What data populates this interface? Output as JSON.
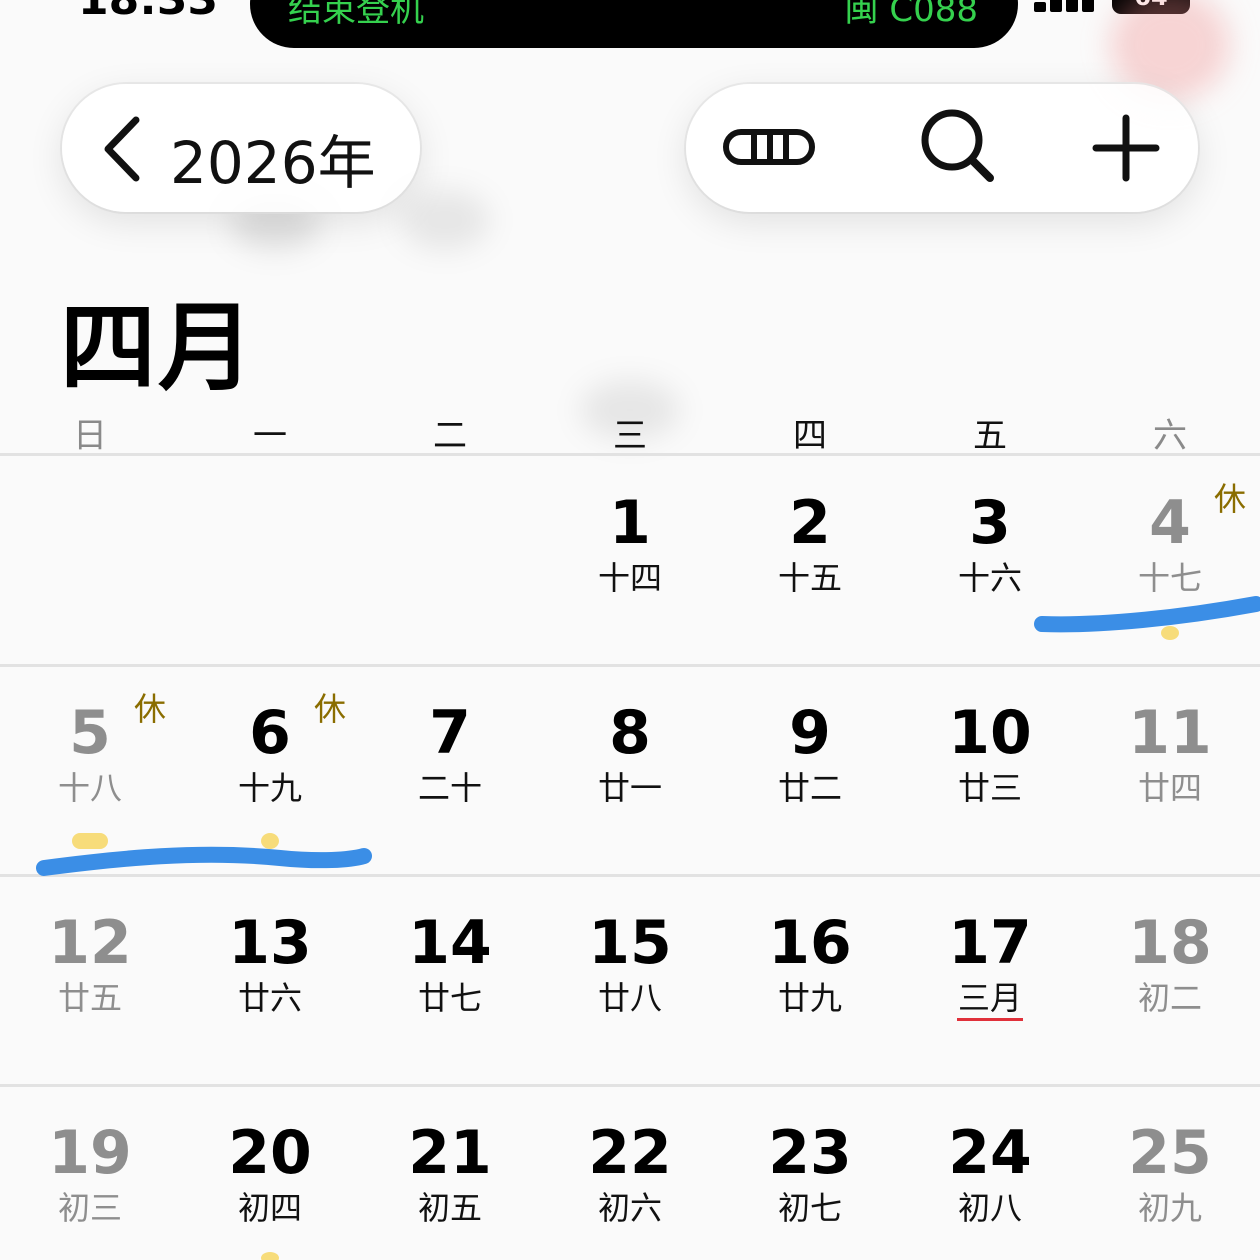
{
  "status_bar": {
    "time": "18:33",
    "island_left": "结束登机",
    "island_right": "闽 C088",
    "battery": "64"
  },
  "nav": {
    "back_year": "2026年",
    "icons": [
      "chevron-left-icon",
      "list-view-icon",
      "search-icon",
      "plus-icon"
    ]
  },
  "month_title": "四月",
  "weekdays": [
    "日",
    "一",
    "二",
    "三",
    "四",
    "五",
    "六"
  ],
  "days": [
    {
      "num": "1",
      "lunar": "十四"
    },
    {
      "num": "2",
      "lunar": "十五"
    },
    {
      "num": "3",
      "lunar": "十六"
    },
    {
      "num": "4",
      "lunar": "十七",
      "tag": "休"
    },
    {
      "num": "5",
      "lunar": "十八",
      "tag": "休"
    },
    {
      "num": "6",
      "lunar": "十九",
      "tag": "休"
    },
    {
      "num": "7",
      "lunar": "二十"
    },
    {
      "num": "8",
      "lunar": "廿一"
    },
    {
      "num": "9",
      "lunar": "廿二"
    },
    {
      "num": "10",
      "lunar": "廿三"
    },
    {
      "num": "11",
      "lunar": "廿四"
    },
    {
      "num": "12",
      "lunar": "廿五"
    },
    {
      "num": "13",
      "lunar": "廿六"
    },
    {
      "num": "14",
      "lunar": "廿七"
    },
    {
      "num": "15",
      "lunar": "廿八"
    },
    {
      "num": "16",
      "lunar": "廿九"
    },
    {
      "num": "17",
      "lunar": "三月"
    },
    {
      "num": "18",
      "lunar": "初二"
    },
    {
      "num": "19",
      "lunar": "初三"
    },
    {
      "num": "20",
      "lunar": "初四"
    },
    {
      "num": "21",
      "lunar": "初五"
    },
    {
      "num": "22",
      "lunar": "初六"
    },
    {
      "num": "23",
      "lunar": "初七"
    },
    {
      "num": "24",
      "lunar": "初八"
    },
    {
      "num": "25",
      "lunar": "初九"
    }
  ],
  "colors": {
    "holiday_tag": "#8a6d00",
    "lunar_month_underline": "#e0303a",
    "annotation_stroke": "#3b8ee6",
    "event_dot": "#f7dc7a",
    "weekend_text": "#8e8e8e",
    "island_text": "#35d14e"
  }
}
